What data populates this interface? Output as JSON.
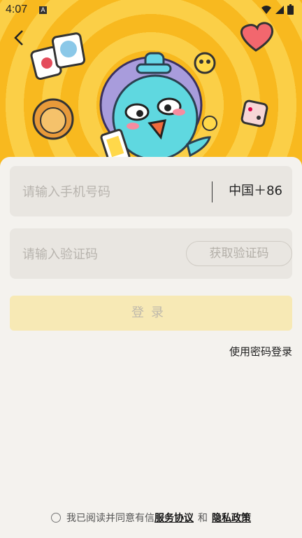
{
  "status_bar": {
    "time": "4:07",
    "badge": "A"
  },
  "form": {
    "phone_placeholder": "请输入手机号码",
    "region_code": "中国＋86",
    "code_placeholder": "请输入验证码",
    "get_code_label": "获取验证码",
    "login_label": "登录",
    "password_login_label": "使用密码登录"
  },
  "agreement": {
    "prefix": "我已阅读并同意有信",
    "service_link": "服务协议",
    "conjunction": "和",
    "privacy_link": "隐私政策"
  },
  "colors": {
    "hero_ring_dark": "#f8b91f",
    "hero_ring_light": "#fbcf47",
    "mascot": "#5fd8e0",
    "login_button": "#f7e9b5"
  },
  "icons": [
    "back-arrow-icon",
    "wifi-icon",
    "signal-icon",
    "battery-icon"
  ]
}
